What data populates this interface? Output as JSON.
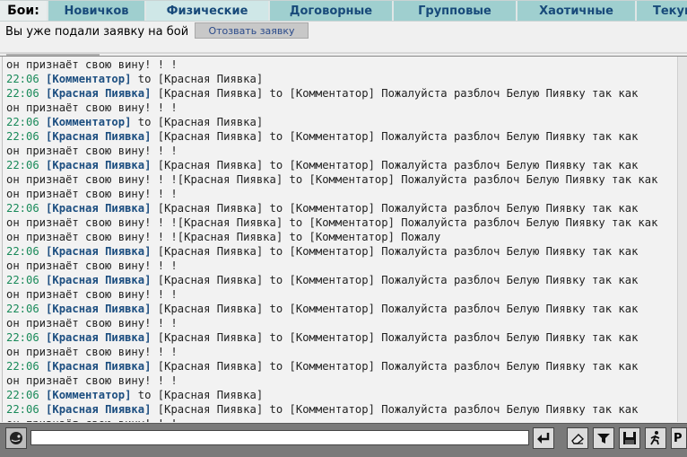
{
  "tabs": {
    "title": "Бои:",
    "items": [
      {
        "label": "Новичков"
      },
      {
        "label": "Физические",
        "active": true
      },
      {
        "label": "Договорные"
      },
      {
        "label": "Групповые"
      },
      {
        "label": "Хаотичные"
      },
      {
        "label": "Текущ"
      }
    ]
  },
  "status": {
    "text": "Вы уже подали заявку на бой",
    "withdraw_label": "Отозвать заявку"
  },
  "chat": {
    "lines": [
      [
        {
          "t": "text",
          "v": "он признаёт свою вину! ! !"
        }
      ],
      [
        {
          "t": "time",
          "v": "22:06"
        },
        {
          "t": "text",
          "v": " "
        },
        {
          "t": "nick",
          "v": "[Комментатор]"
        },
        {
          "t": "text",
          "v": " to [Красная Пиявка]"
        }
      ],
      [
        {
          "t": "time",
          "v": "22:06"
        },
        {
          "t": "text",
          "v": " "
        },
        {
          "t": "nick",
          "v": "[Красная Пиявка]"
        },
        {
          "t": "text",
          "v": " [Красная Пиявка] to [Комментатор] Пожалуйста разблоч Белую Пиявку так как"
        }
      ],
      [
        {
          "t": "text",
          "v": "он признаёт свою вину! ! !"
        }
      ],
      [
        {
          "t": "time",
          "v": "22:06"
        },
        {
          "t": "text",
          "v": " "
        },
        {
          "t": "nick",
          "v": "[Комментатор]"
        },
        {
          "t": "text",
          "v": " to [Красная Пиявка]"
        }
      ],
      [
        {
          "t": "time",
          "v": "22:06"
        },
        {
          "t": "text",
          "v": " "
        },
        {
          "t": "nick",
          "v": "[Красная Пиявка]"
        },
        {
          "t": "text",
          "v": " [Красная Пиявка] to [Комментатор] Пожалуйста разблоч Белую Пиявку так как"
        }
      ],
      [
        {
          "t": "text",
          "v": "он признаёт свою вину! ! !"
        }
      ],
      [
        {
          "t": "time",
          "v": "22:06"
        },
        {
          "t": "text",
          "v": " "
        },
        {
          "t": "nick",
          "v": "[Красная Пиявка]"
        },
        {
          "t": "text",
          "v": " [Красная Пиявка] to [Комментатор] Пожалуйста разблоч Белую Пиявку так как"
        }
      ],
      [
        {
          "t": "text",
          "v": "он признаёт свою вину! ! ![Красная Пиявка] to [Комментатор] Пожалуйста разблоч Белую Пиявку так как"
        }
      ],
      [
        {
          "t": "text",
          "v": "он признаёт свою вину! ! !"
        }
      ],
      [
        {
          "t": "time",
          "v": "22:06"
        },
        {
          "t": "text",
          "v": " "
        },
        {
          "t": "nick",
          "v": "[Красная Пиявка]"
        },
        {
          "t": "text",
          "v": " [Красная Пиявка] to [Комментатор] Пожалуйста разблоч Белую Пиявку так как"
        }
      ],
      [
        {
          "t": "text",
          "v": "он признаёт свою вину! ! ![Красная Пиявка] to [Комментатор] Пожалуйста разблоч Белую Пиявку так как"
        }
      ],
      [
        {
          "t": "text",
          "v": "он признаёт свою вину! ! ![Красная Пиявка] to [Комментатор] Пожалу"
        }
      ],
      [
        {
          "t": "time",
          "v": "22:06"
        },
        {
          "t": "text",
          "v": " "
        },
        {
          "t": "nick",
          "v": "[Красная Пиявка]"
        },
        {
          "t": "text",
          "v": " [Красная Пиявка] to [Комментатор] Пожалуйста разблоч Белую Пиявку так как"
        }
      ],
      [
        {
          "t": "text",
          "v": "он признаёт свою вину! ! !"
        }
      ],
      [
        {
          "t": "time",
          "v": "22:06"
        },
        {
          "t": "text",
          "v": " "
        },
        {
          "t": "nick",
          "v": "[Красная Пиявка]"
        },
        {
          "t": "text",
          "v": " [Красная Пиявка] to [Комментатор] Пожалуйста разблоч Белую Пиявку так как"
        }
      ],
      [
        {
          "t": "text",
          "v": "он признаёт свою вину! ! !"
        }
      ],
      [
        {
          "t": "time",
          "v": "22:06"
        },
        {
          "t": "text",
          "v": " "
        },
        {
          "t": "nick",
          "v": "[Красная Пиявка]"
        },
        {
          "t": "text",
          "v": " [Красная Пиявка] to [Комментатор] Пожалуйста разблоч Белую Пиявку так как"
        }
      ],
      [
        {
          "t": "text",
          "v": "он признаёт свою вину! ! !"
        }
      ],
      [
        {
          "t": "time",
          "v": "22:06"
        },
        {
          "t": "text",
          "v": " "
        },
        {
          "t": "nick",
          "v": "[Красная Пиявка]"
        },
        {
          "t": "text",
          "v": " [Красная Пиявка] to [Комментатор] Пожалуйста разблоч Белую Пиявку так как"
        }
      ],
      [
        {
          "t": "text",
          "v": "он признаёт свою вину! ! !"
        }
      ],
      [
        {
          "t": "time",
          "v": "22:06"
        },
        {
          "t": "text",
          "v": " "
        },
        {
          "t": "nick",
          "v": "[Красная Пиявка]"
        },
        {
          "t": "text",
          "v": " [Красная Пиявка] to [Комментатор] Пожалуйста разблоч Белую Пиявку так как"
        }
      ],
      [
        {
          "t": "text",
          "v": "он признаёт свою вину! ! !"
        }
      ],
      [
        {
          "t": "time",
          "v": "22:06"
        },
        {
          "t": "text",
          "v": " "
        },
        {
          "t": "nick",
          "v": "[Комментатор]"
        },
        {
          "t": "text",
          "v": " to [Красная Пиявка]"
        }
      ],
      [
        {
          "t": "time",
          "v": "22:06"
        },
        {
          "t": "text",
          "v": " "
        },
        {
          "t": "nick",
          "v": "[Красная Пиявка]"
        },
        {
          "t": "text",
          "v": " [Красная Пиявка] to [Комментатор] Пожалуйста разблоч Белую Пиявку так как"
        }
      ],
      [
        {
          "t": "text",
          "v": "он признаёт свою вину! ! !"
        }
      ]
    ]
  },
  "input": {
    "value": ""
  },
  "toolbar": {
    "icons": [
      "smiley-icon",
      "enter-icon",
      "eraser-icon",
      "filter-icon",
      "save-icon",
      "walker-icon",
      "translit-icon"
    ],
    "translit_label": "P"
  }
}
